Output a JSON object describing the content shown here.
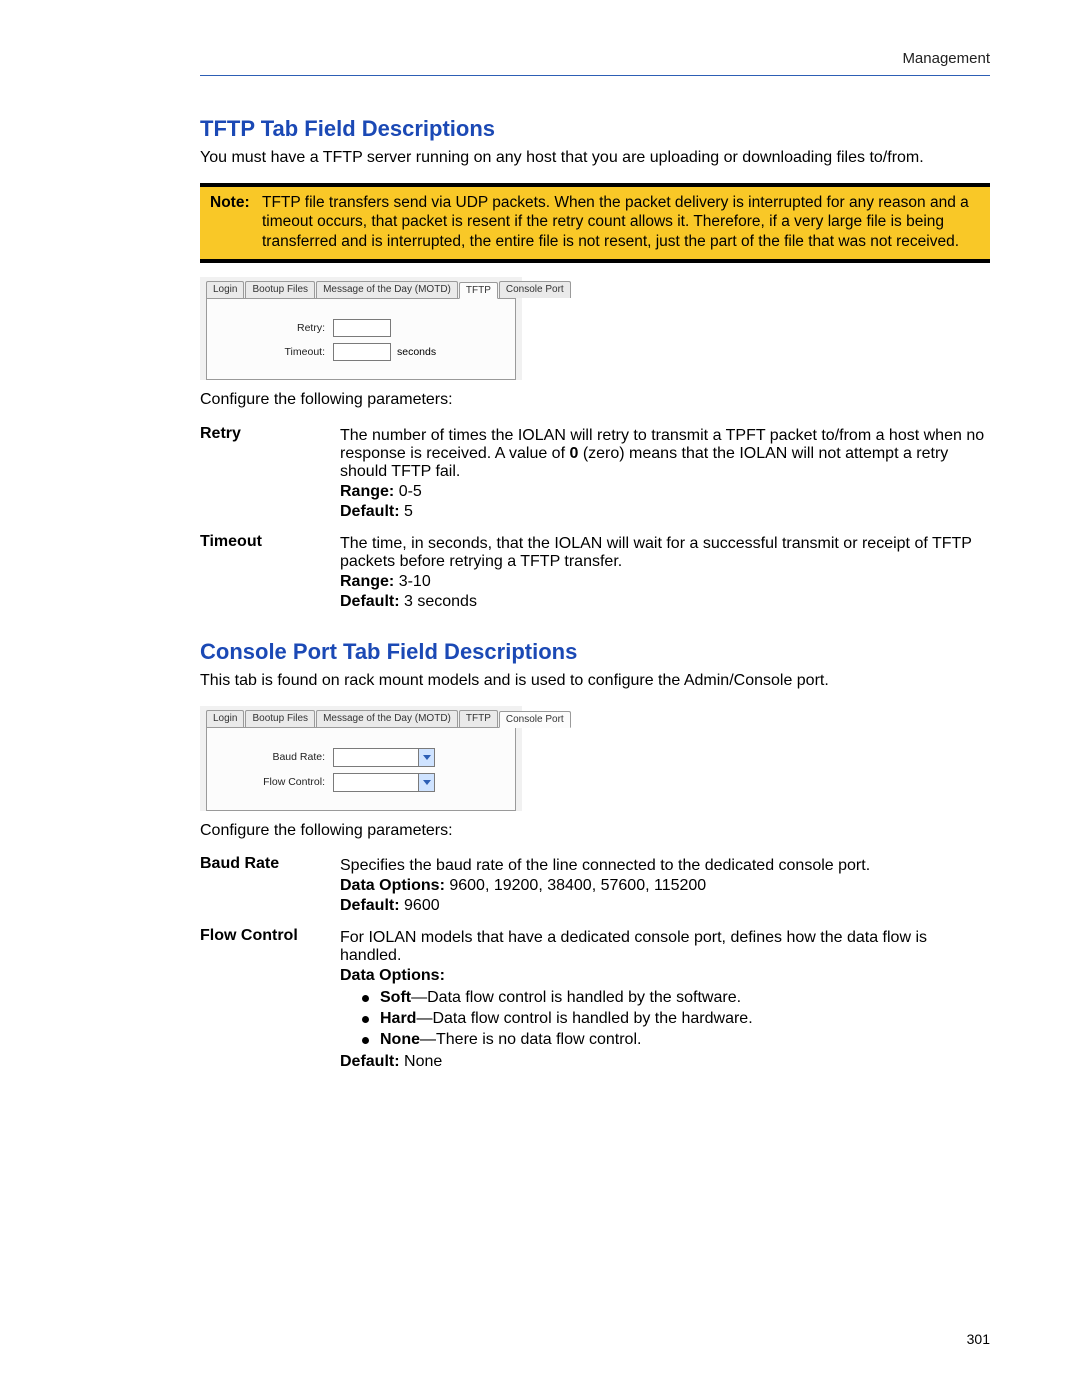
{
  "header": {
    "section": "Management"
  },
  "tftp": {
    "heading": "TFTP Tab Field Descriptions",
    "intro": "You must have a TFTP server running on any host that you are uploading or downloading files to/from.",
    "note_label": "Note:",
    "note_text": "TFTP file transfers send via UDP packets. When the packet delivery is interrupted for any reason and a timeout occurs, that packet is resent if the retry count allows it. Therefore, if a very large file is being transferred and is interrupted, the entire file is not resent, just the part of the file that was not received.",
    "tabs": [
      "Login",
      "Bootup Files",
      "Message of the Day (MOTD)",
      "TFTP",
      "Console Port"
    ],
    "active_tab_index": 3,
    "form": {
      "retry_label": "Retry:",
      "timeout_label": "Timeout:",
      "timeout_suffix": "seconds"
    },
    "config_line": "Configure the following parameters:",
    "params": {
      "retry": {
        "name": "Retry",
        "desc_pre": "The number of times the IOLAN will retry to transmit a TPFT packet to/from a host when no response is received. A value of ",
        "desc_bold": "0",
        "desc_post": " (zero) means that the IOLAN will not attempt a retry should TFTP fail.",
        "range_label": "Range:",
        "range_value": "0-5",
        "default_label": "Default:",
        "default_value": "5"
      },
      "timeout": {
        "name": "Timeout",
        "desc": "The time, in seconds, that the IOLAN will wait for a successful transmit or receipt of TFTP packets before retrying a TFTP transfer.",
        "range_label": "Range:",
        "range_value": "3-10",
        "default_label": "Default:",
        "default_value": "3 seconds"
      }
    }
  },
  "console": {
    "heading": "Console Port Tab Field Descriptions",
    "intro": "This tab is found on rack mount models and is used to configure the Admin/Console port.",
    "tabs": [
      "Login",
      "Bootup Files",
      "Message of the Day (MOTD)",
      "TFTP",
      "Console Port"
    ],
    "active_tab_index": 4,
    "form": {
      "baud_label": "Baud Rate:",
      "flow_label": "Flow Control:"
    },
    "config_line": "Configure the following parameters:",
    "params": {
      "baud": {
        "name": "Baud Rate",
        "desc": "Specifies the baud rate of the line connected to the dedicated console port.",
        "options_label": "Data Options:",
        "options_value": "9600, 19200, 38400, 57600, 115200",
        "default_label": "Default:",
        "default_value": "9600"
      },
      "flow": {
        "name": "Flow Control",
        "desc": "For IOLAN models that have a dedicated console port, defines how the data flow is handled.",
        "options_label": "Data Options:",
        "bullets": [
          {
            "term": "Soft",
            "desc": "—Data flow control is handled by the software."
          },
          {
            "term": "Hard",
            "desc": "—Data flow control is handled by the hardware."
          },
          {
            "term": "None",
            "desc": "—There is no data flow control."
          }
        ],
        "default_label": "Default:",
        "default_value": "None"
      }
    }
  },
  "page_number": "301"
}
